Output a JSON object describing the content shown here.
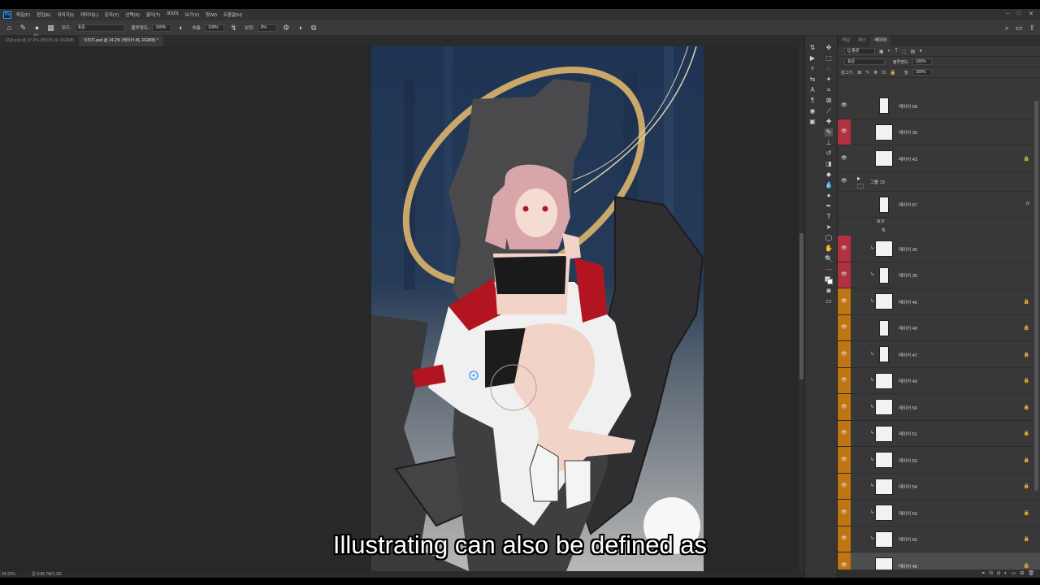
{
  "app": {
    "logo": "Ps"
  },
  "menu": [
    "파일(F)",
    "편집(E)",
    "이미지(I)",
    "레이어(L)",
    "문자(Y)",
    "선택(S)",
    "필터(T)",
    "3D(D)",
    "보기(V)",
    "창(W)",
    "도움말(H)"
  ],
  "window_controls": [
    "–",
    "□",
    "✕"
  ],
  "options": {
    "brush_size": "151",
    "mode_label": "모드:",
    "mode_value": "표준",
    "opacity_label": "불투명도:",
    "opacity_value": "100%",
    "flow_label": "흐름:",
    "flow_value": "100%",
    "smoothing_label": "보정:",
    "smoothing_value": "0%"
  },
  "doc_tabs": [
    {
      "label": "13강.psd @ 37.2% (레이어 20, RGB/8)"
    },
    {
      "label": "이미지.psd @ 24.2% (레이어 45, RGB/8) *"
    }
  ],
  "status": {
    "zoom": "24.22%",
    "doc_info": "문서:86.7M/1.3G"
  },
  "panel": {
    "tabs": [
      "채널",
      "패스",
      "레이어"
    ],
    "filter_label": "Q 종류",
    "blend_mode": "표준",
    "opacity_label": "불투명도:",
    "opacity_value": "100%",
    "lock_label": "잠그기:",
    "fill_label": "칠:",
    "fill_value": "100%"
  },
  "layers": [
    {
      "name": "레이어 58",
      "color": "",
      "thumb": "narrow",
      "lock": false,
      "clip": false
    },
    {
      "name": "레이어 39",
      "color": "#b0323e",
      "thumb": "wide",
      "lock": false,
      "clip": false
    },
    {
      "name": "레이어 43",
      "color": "",
      "thumb": "wide",
      "lock": true,
      "clip": false
    },
    {
      "name": "그룹 13",
      "color": "",
      "thumb": "folder",
      "lock": false,
      "clip": false,
      "group": true
    },
    {
      "name": "레이어 57",
      "color": "",
      "thumb": "narrow",
      "lock": false,
      "clip": false,
      "fx": true,
      "effects": [
        "효과",
        "획"
      ]
    },
    {
      "name": "레이어 36",
      "color": "#b0323e",
      "thumb": "wide",
      "lock": false,
      "clip": true
    },
    {
      "name": "레이어 35",
      "color": "#b0323e",
      "thumb": "narrow",
      "lock": false,
      "clip": true
    },
    {
      "name": "레이어 46",
      "color": "#c07412",
      "thumb": "wide",
      "lock": true,
      "clip": true
    },
    {
      "name": "레이어 48",
      "color": "#c07412",
      "thumb": "narrow",
      "lock": true,
      "clip": false
    },
    {
      "name": "레이어 47",
      "color": "#c07412",
      "thumb": "narrow",
      "lock": true,
      "clip": true
    },
    {
      "name": "레이어 49",
      "color": "#c07412",
      "thumb": "wide",
      "lock": true,
      "clip": true
    },
    {
      "name": "레이어 50",
      "color": "#c07412",
      "thumb": "wide",
      "lock": true,
      "clip": true
    },
    {
      "name": "레이어 51",
      "color": "#c07412",
      "thumb": "wide",
      "lock": true,
      "clip": true
    },
    {
      "name": "레이어 52",
      "color": "#c07412",
      "thumb": "wide",
      "lock": true,
      "clip": true
    },
    {
      "name": "레이어 54",
      "color": "#c07412",
      "thumb": "wide",
      "lock": true,
      "clip": true
    },
    {
      "name": "레이어 53",
      "color": "#c07412",
      "thumb": "wide",
      "lock": true,
      "clip": true
    },
    {
      "name": "레이어 55",
      "color": "#c07412",
      "thumb": "wide",
      "lock": true,
      "clip": true
    },
    {
      "name": "레이어 45",
      "color": "#c07412",
      "thumb": "wide",
      "lock": true,
      "clip": false,
      "selected": true
    }
  ],
  "caption": "Illustrating can also be defined as"
}
